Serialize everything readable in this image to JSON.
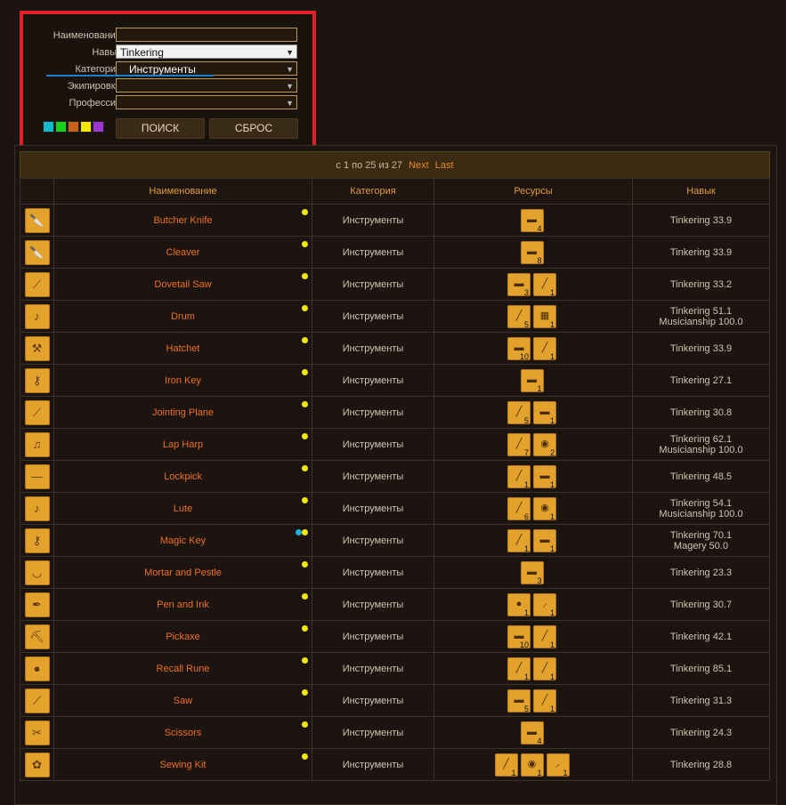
{
  "filters": {
    "name_label": "Наименование:",
    "name_value": "",
    "skill_label": "Навык:",
    "skill_value": "Tinkering",
    "category_label": "Категория:",
    "category_value": "Инструменты",
    "equip_label": "Экипировка:",
    "equip_value": "",
    "profession_label": "Профессия:",
    "profession_value": "",
    "search_label": "ПОИСК",
    "reset_label": "СБРОС",
    "swatches": [
      "#14b8c8",
      "#18d018",
      "#c8641a",
      "#f8e800",
      "#9838d0"
    ]
  },
  "pager": {
    "text": "с 1 по 25 из 27",
    "next": "Next",
    "last": "Last"
  },
  "columns": [
    "",
    "Наименование",
    "Категория",
    "Ресурсы",
    "Навык"
  ],
  "rows": [
    {
      "name": "Butcher Knife",
      "icon": "knife-icon",
      "glyph": "🔪",
      "cat": "Инструменты",
      "dots": [
        "yellow"
      ],
      "res": [
        {
          "icon": "ingot-icon",
          "count": "4"
        }
      ],
      "skill": [
        "Tinkering 33.9"
      ]
    },
    {
      "name": "Cleaver",
      "icon": "cleaver-icon",
      "glyph": "🔪",
      "cat": "Инструменты",
      "dots": [
        "yellow"
      ],
      "res": [
        {
          "icon": "ingot-icon",
          "count": "8"
        }
      ],
      "skill": [
        "Tinkering 33.9"
      ]
    },
    {
      "name": "Dovetail Saw",
      "icon": "saw-icon",
      "glyph": "⟋",
      "cat": "Инструменты",
      "dots": [
        "yellow"
      ],
      "res": [
        {
          "icon": "ingot-icon",
          "count": "3"
        },
        {
          "icon": "board-icon",
          "count": "1"
        }
      ],
      "skill": [
        "Tinkering 33.2"
      ]
    },
    {
      "name": "Drum",
      "icon": "drum-icon",
      "glyph": "♪",
      "cat": "Инструменты",
      "dots": [
        "yellow"
      ],
      "res": [
        {
          "icon": "board-icon",
          "count": "5"
        },
        {
          "icon": "hide-icon",
          "count": "1"
        }
      ],
      "skill": [
        "Tinkering 51.1",
        "Musicianship 100.0"
      ]
    },
    {
      "name": "Hatchet",
      "icon": "hatchet-icon",
      "glyph": "⚒",
      "cat": "Инструменты",
      "dots": [
        "yellow"
      ],
      "res": [
        {
          "icon": "ingot-icon",
          "count": "10"
        },
        {
          "icon": "board-icon",
          "count": "1"
        }
      ],
      "skill": [
        "Tinkering 33.9"
      ]
    },
    {
      "name": "Iron Key",
      "icon": "key-icon",
      "glyph": "⚷",
      "cat": "Инструменты",
      "dots": [
        "yellow"
      ],
      "res": [
        {
          "icon": "ingot-icon",
          "count": "1"
        }
      ],
      "skill": [
        "Tinkering 27.1"
      ]
    },
    {
      "name": "Jointing Plane",
      "icon": "plane-icon",
      "glyph": "⟋",
      "cat": "Инструменты",
      "dots": [
        "yellow"
      ],
      "res": [
        {
          "icon": "board-icon",
          "count": "5"
        },
        {
          "icon": "ingot-icon",
          "count": "1"
        }
      ],
      "skill": [
        "Tinkering 30.8"
      ]
    },
    {
      "name": "Lap Harp",
      "icon": "harp-icon",
      "glyph": "♫",
      "cat": "Инструменты",
      "dots": [
        "yellow"
      ],
      "res": [
        {
          "icon": "board-icon",
          "count": "7"
        },
        {
          "icon": "cloth-icon",
          "count": "2"
        }
      ],
      "skill": [
        "Tinkering 62.1",
        "Musicianship 100.0"
      ]
    },
    {
      "name": "Lockpick",
      "icon": "lockpick-icon",
      "glyph": "—",
      "cat": "Инструменты",
      "dots": [
        "yellow"
      ],
      "res": [
        {
          "icon": "board-icon",
          "count": "1"
        },
        {
          "icon": "ingot-icon",
          "count": "1"
        }
      ],
      "skill": [
        "Tinkering 48.5"
      ]
    },
    {
      "name": "Lute",
      "icon": "lute-icon",
      "glyph": "♪",
      "cat": "Инструменты",
      "dots": [
        "yellow"
      ],
      "res": [
        {
          "icon": "board-icon",
          "count": "6"
        },
        {
          "icon": "cloth-icon",
          "count": "1"
        }
      ],
      "skill": [
        "Tinkering 54.1",
        "Musicianship 100.0"
      ]
    },
    {
      "name": "Magic Key",
      "icon": "magic-key-icon",
      "glyph": "⚷",
      "cat": "Инструменты",
      "dots": [
        "cyan",
        "yellow"
      ],
      "res": [
        {
          "icon": "board-icon",
          "count": "1"
        },
        {
          "icon": "ingot-icon",
          "count": "1"
        }
      ],
      "skill": [
        "Tinkering 70.1",
        "Magery 50.0"
      ]
    },
    {
      "name": "Mortar and Pestle",
      "icon": "mortar-icon",
      "glyph": "◡",
      "cat": "Инструменты",
      "dots": [
        "yellow"
      ],
      "res": [
        {
          "icon": "ingot-icon",
          "count": "3"
        }
      ],
      "skill": [
        "Tinkering 23.3"
      ]
    },
    {
      "name": "Pen and Ink",
      "icon": "pen-icon",
      "glyph": "✒",
      "cat": "Инструменты",
      "dots": [
        "yellow"
      ],
      "res": [
        {
          "icon": "ink-icon",
          "count": "1"
        },
        {
          "icon": "feather-icon",
          "count": "1"
        }
      ],
      "skill": [
        "Tinkering 30.7"
      ]
    },
    {
      "name": "Pickaxe",
      "icon": "pickaxe-icon",
      "glyph": "⛏",
      "cat": "Инструменты",
      "dots": [
        "yellow"
      ],
      "res": [
        {
          "icon": "ingot-icon",
          "count": "10"
        },
        {
          "icon": "board-icon",
          "count": "1"
        }
      ],
      "skill": [
        "Tinkering 42.1"
      ]
    },
    {
      "name": "Recall Rune",
      "icon": "rune-icon",
      "glyph": "●",
      "cat": "Инструменты",
      "dots": [
        "yellow"
      ],
      "res": [
        {
          "icon": "board-icon",
          "count": "1"
        },
        {
          "icon": "board-icon",
          "count": "1"
        }
      ],
      "skill": [
        "Tinkering 85.1"
      ]
    },
    {
      "name": "Saw",
      "icon": "saw-icon",
      "glyph": "⟋",
      "cat": "Инструменты",
      "dots": [
        "yellow"
      ],
      "res": [
        {
          "icon": "ingot-icon",
          "count": "5"
        },
        {
          "icon": "board-icon",
          "count": "1"
        }
      ],
      "skill": [
        "Tinkering 31.3"
      ]
    },
    {
      "name": "Scissors",
      "icon": "scissors-icon",
      "glyph": "✂",
      "cat": "Инструменты",
      "dots": [
        "yellow"
      ],
      "res": [
        {
          "icon": "ingot-icon",
          "count": "4"
        }
      ],
      "skill": [
        "Tinkering 24.3"
      ]
    },
    {
      "name": "Sewing Kit",
      "icon": "sewing-kit-icon",
      "glyph": "✿",
      "cat": "Инструменты",
      "dots": [
        "yellow"
      ],
      "res": [
        {
          "icon": "board-icon",
          "count": "1"
        },
        {
          "icon": "cloth-icon",
          "count": "1"
        },
        {
          "icon": "feather-icon",
          "count": "1"
        }
      ],
      "skill": [
        "Tinkering 28.8"
      ]
    }
  ]
}
